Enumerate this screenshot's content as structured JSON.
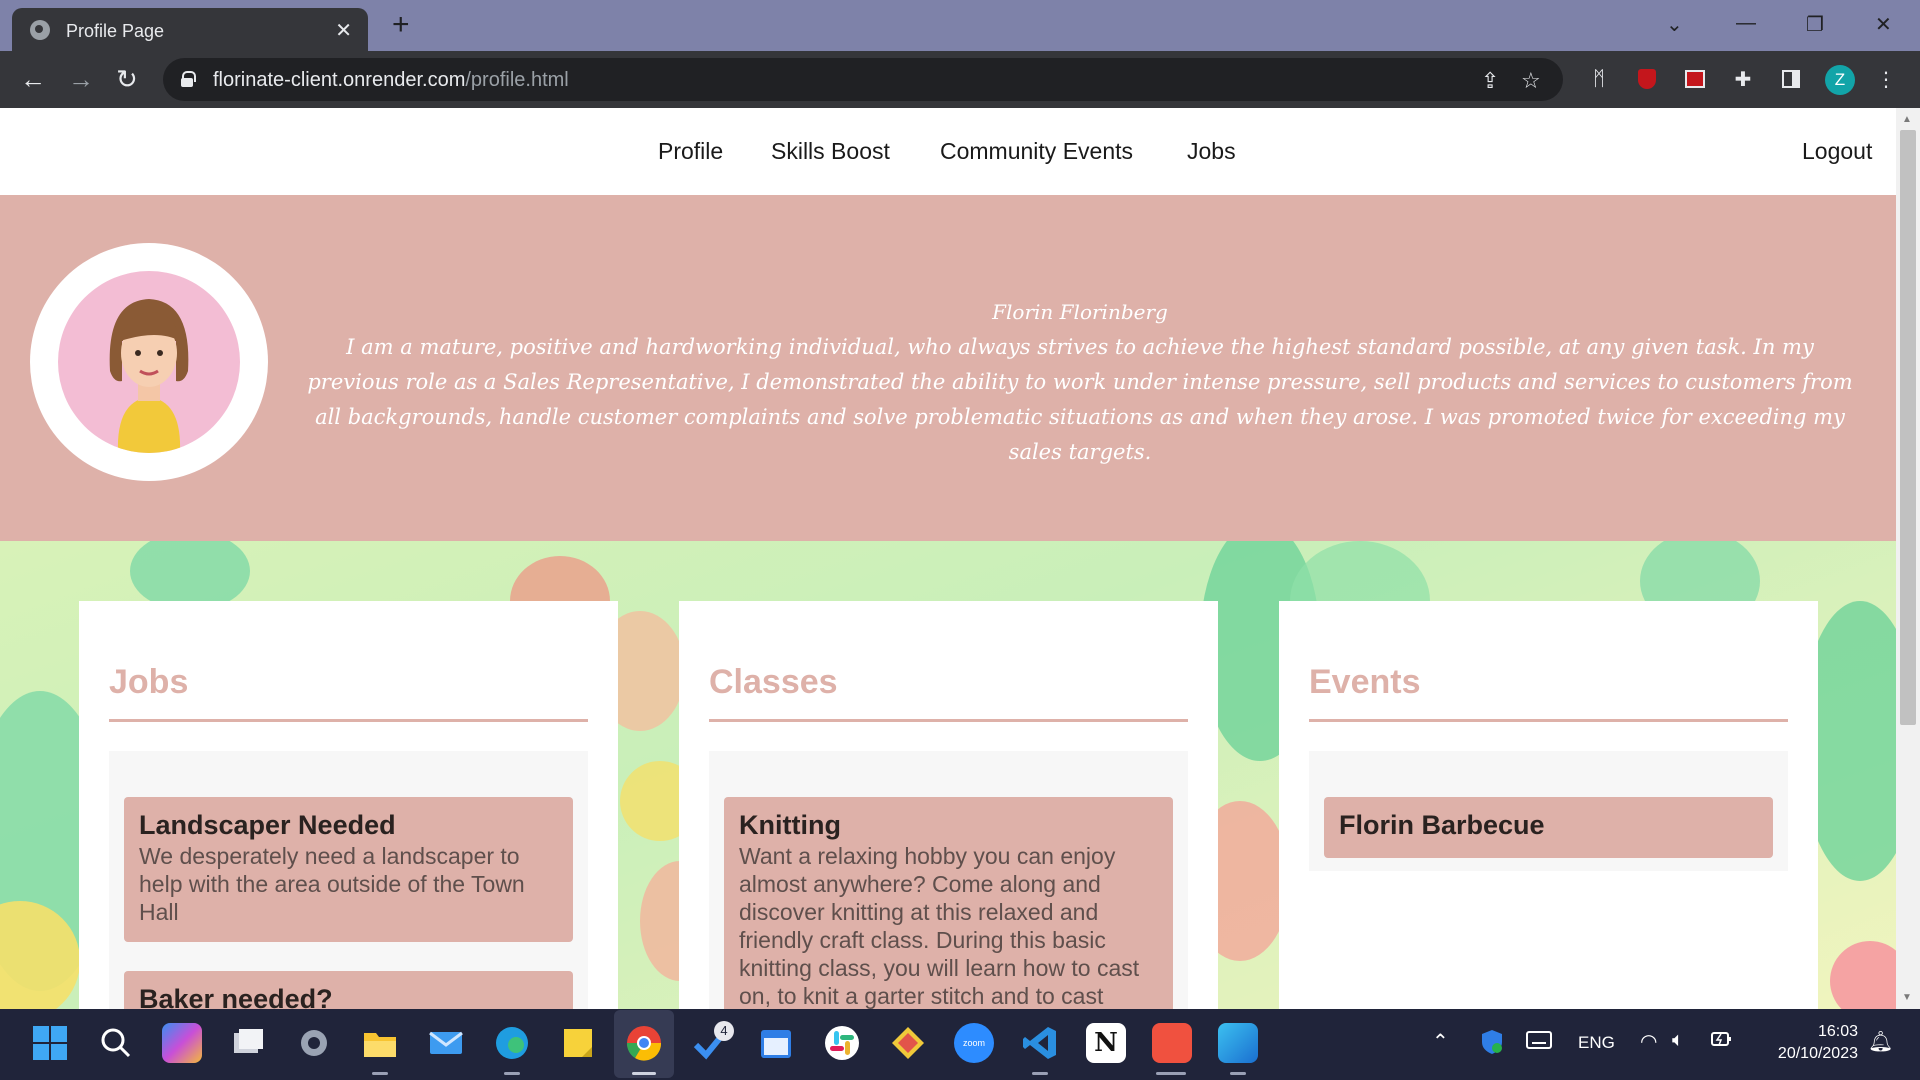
{
  "browser": {
    "tab_title": "Profile Page",
    "tab_close": "✕",
    "new_tab": "+",
    "url_host": "florinate-client.onrender.com",
    "url_path": "/profile.html",
    "window_controls": [
      "⌄",
      "—",
      "❐",
      "✕"
    ],
    "profile_initial": "Z"
  },
  "nav": {
    "links": [
      "Profile",
      "Skills Boost",
      "Community Events",
      "Jobs"
    ],
    "logout": "Logout"
  },
  "profile": {
    "name": "Florin Florinberg",
    "bio": "I am a mature, positive and hardworking individual, who always strives to achieve the highest standard possible, at any given task. In my previous role as a Sales Representative, I demonstrated the ability to work under intense pressure, sell products and services to customers from all backgrounds, handle customer complaints and solve problematic situations as and when they arose. I was promoted twice for exceeding my sales targets."
  },
  "jobs": {
    "heading": "Jobs",
    "items": [
      {
        "title": "Landscaper Needed",
        "desc": "We desperately need a landscaper to help with the area outside of the Town Hall"
      },
      {
        "title": "Baker needed?",
        "desc": ""
      }
    ]
  },
  "classes": {
    "heading": "Classes",
    "items": [
      {
        "title": "Knitting",
        "desc": "Want a relaxing hobby you can enjoy almost anywhere? Come along and discover knitting at this relaxed and friendly craft class. During this basic knitting class, you will learn how to cast on, to knit a garter stitch and to cast"
      }
    ]
  },
  "events": {
    "heading": "Events",
    "items": [
      {
        "title": "Florin Barbecue"
      }
    ]
  },
  "taskbar": {
    "badge_count": "4",
    "language": "ENG",
    "time": "16:03",
    "date": "20/10/2023"
  },
  "colors": {
    "accent": "#deb1a9",
    "tabbar": "#7e82a9",
    "chrome_dark": "#35363a",
    "taskbar": "#20243a"
  }
}
